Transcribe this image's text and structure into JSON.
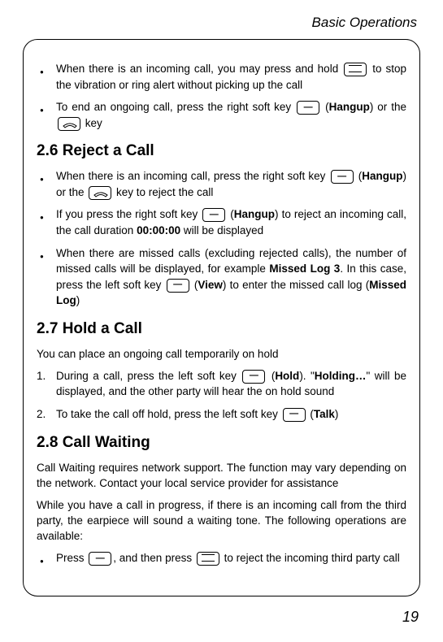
{
  "header": "Basic Operations",
  "page_number": "19",
  "sections": {
    "reject_heading": "2.6 Reject a Call",
    "hold_heading": "2.7 Hold a Call",
    "waiting_heading": "2.8 Call Waiting"
  },
  "bullets": {
    "b1_a": "When there is an incoming call, you may press and hold ",
    "b1_b": " to stop the vibration or ring alert without picking up the call",
    "b2_a": "To end an ongoing call, press the right soft key ",
    "b2_b": " (",
    "b2_c": "Hangup",
    "b2_d": ") or the ",
    "b2_e": " key",
    "b3_a": "When there is an incoming call, press the right soft key ",
    "b3_b": " (",
    "b3_c": "Hangup",
    "b3_d": ") or the ",
    "b3_e": " key to reject the call",
    "b4_a": "If you press the right soft key ",
    "b4_b": " (",
    "b4_c": "Hangup",
    "b4_d": ") to reject an incoming call, the call duration ",
    "b4_e": "00:00:00",
    "b4_f": " will be displayed",
    "b5_a": "When there are missed calls (excluding rejected calls), the number of missed calls will be displayed, for example ",
    "b5_b": "Missed Log 3",
    "b5_c": ". In this case, press the left soft key ",
    "b5_d": " (",
    "b5_e": "View",
    "b5_f": ") to enter the missed call log (",
    "b5_g": "Missed Log",
    "b5_h": ")",
    "hold_intro": "You can place an ongoing call temporarily on hold",
    "n1_num": "1.",
    "n1_a": "During a call, press the left soft key ",
    "n1_b": " (",
    "n1_c": "Hold",
    "n1_d": "). \"",
    "n1_e": "Holding…",
    "n1_f": "\" will be displayed, and the other party will hear the on hold sound",
    "n2_num": "2.",
    "n2_a": "To take the call off hold, press the left soft key ",
    "n2_b": " (",
    "n2_c": "Talk",
    "n2_d": ")",
    "wait_p1": "Call Waiting requires network support. The function may vary depending on the network. Contact your local service provider for assistance",
    "wait_p2": "While you have a call in progress, if there is an incoming call from the third party, the earpiece will sound a waiting tone. The following operations are available:",
    "b6_a": "Press ",
    "b6_b": ", and then press ",
    "b6_c": " to reject the incoming third party call"
  }
}
